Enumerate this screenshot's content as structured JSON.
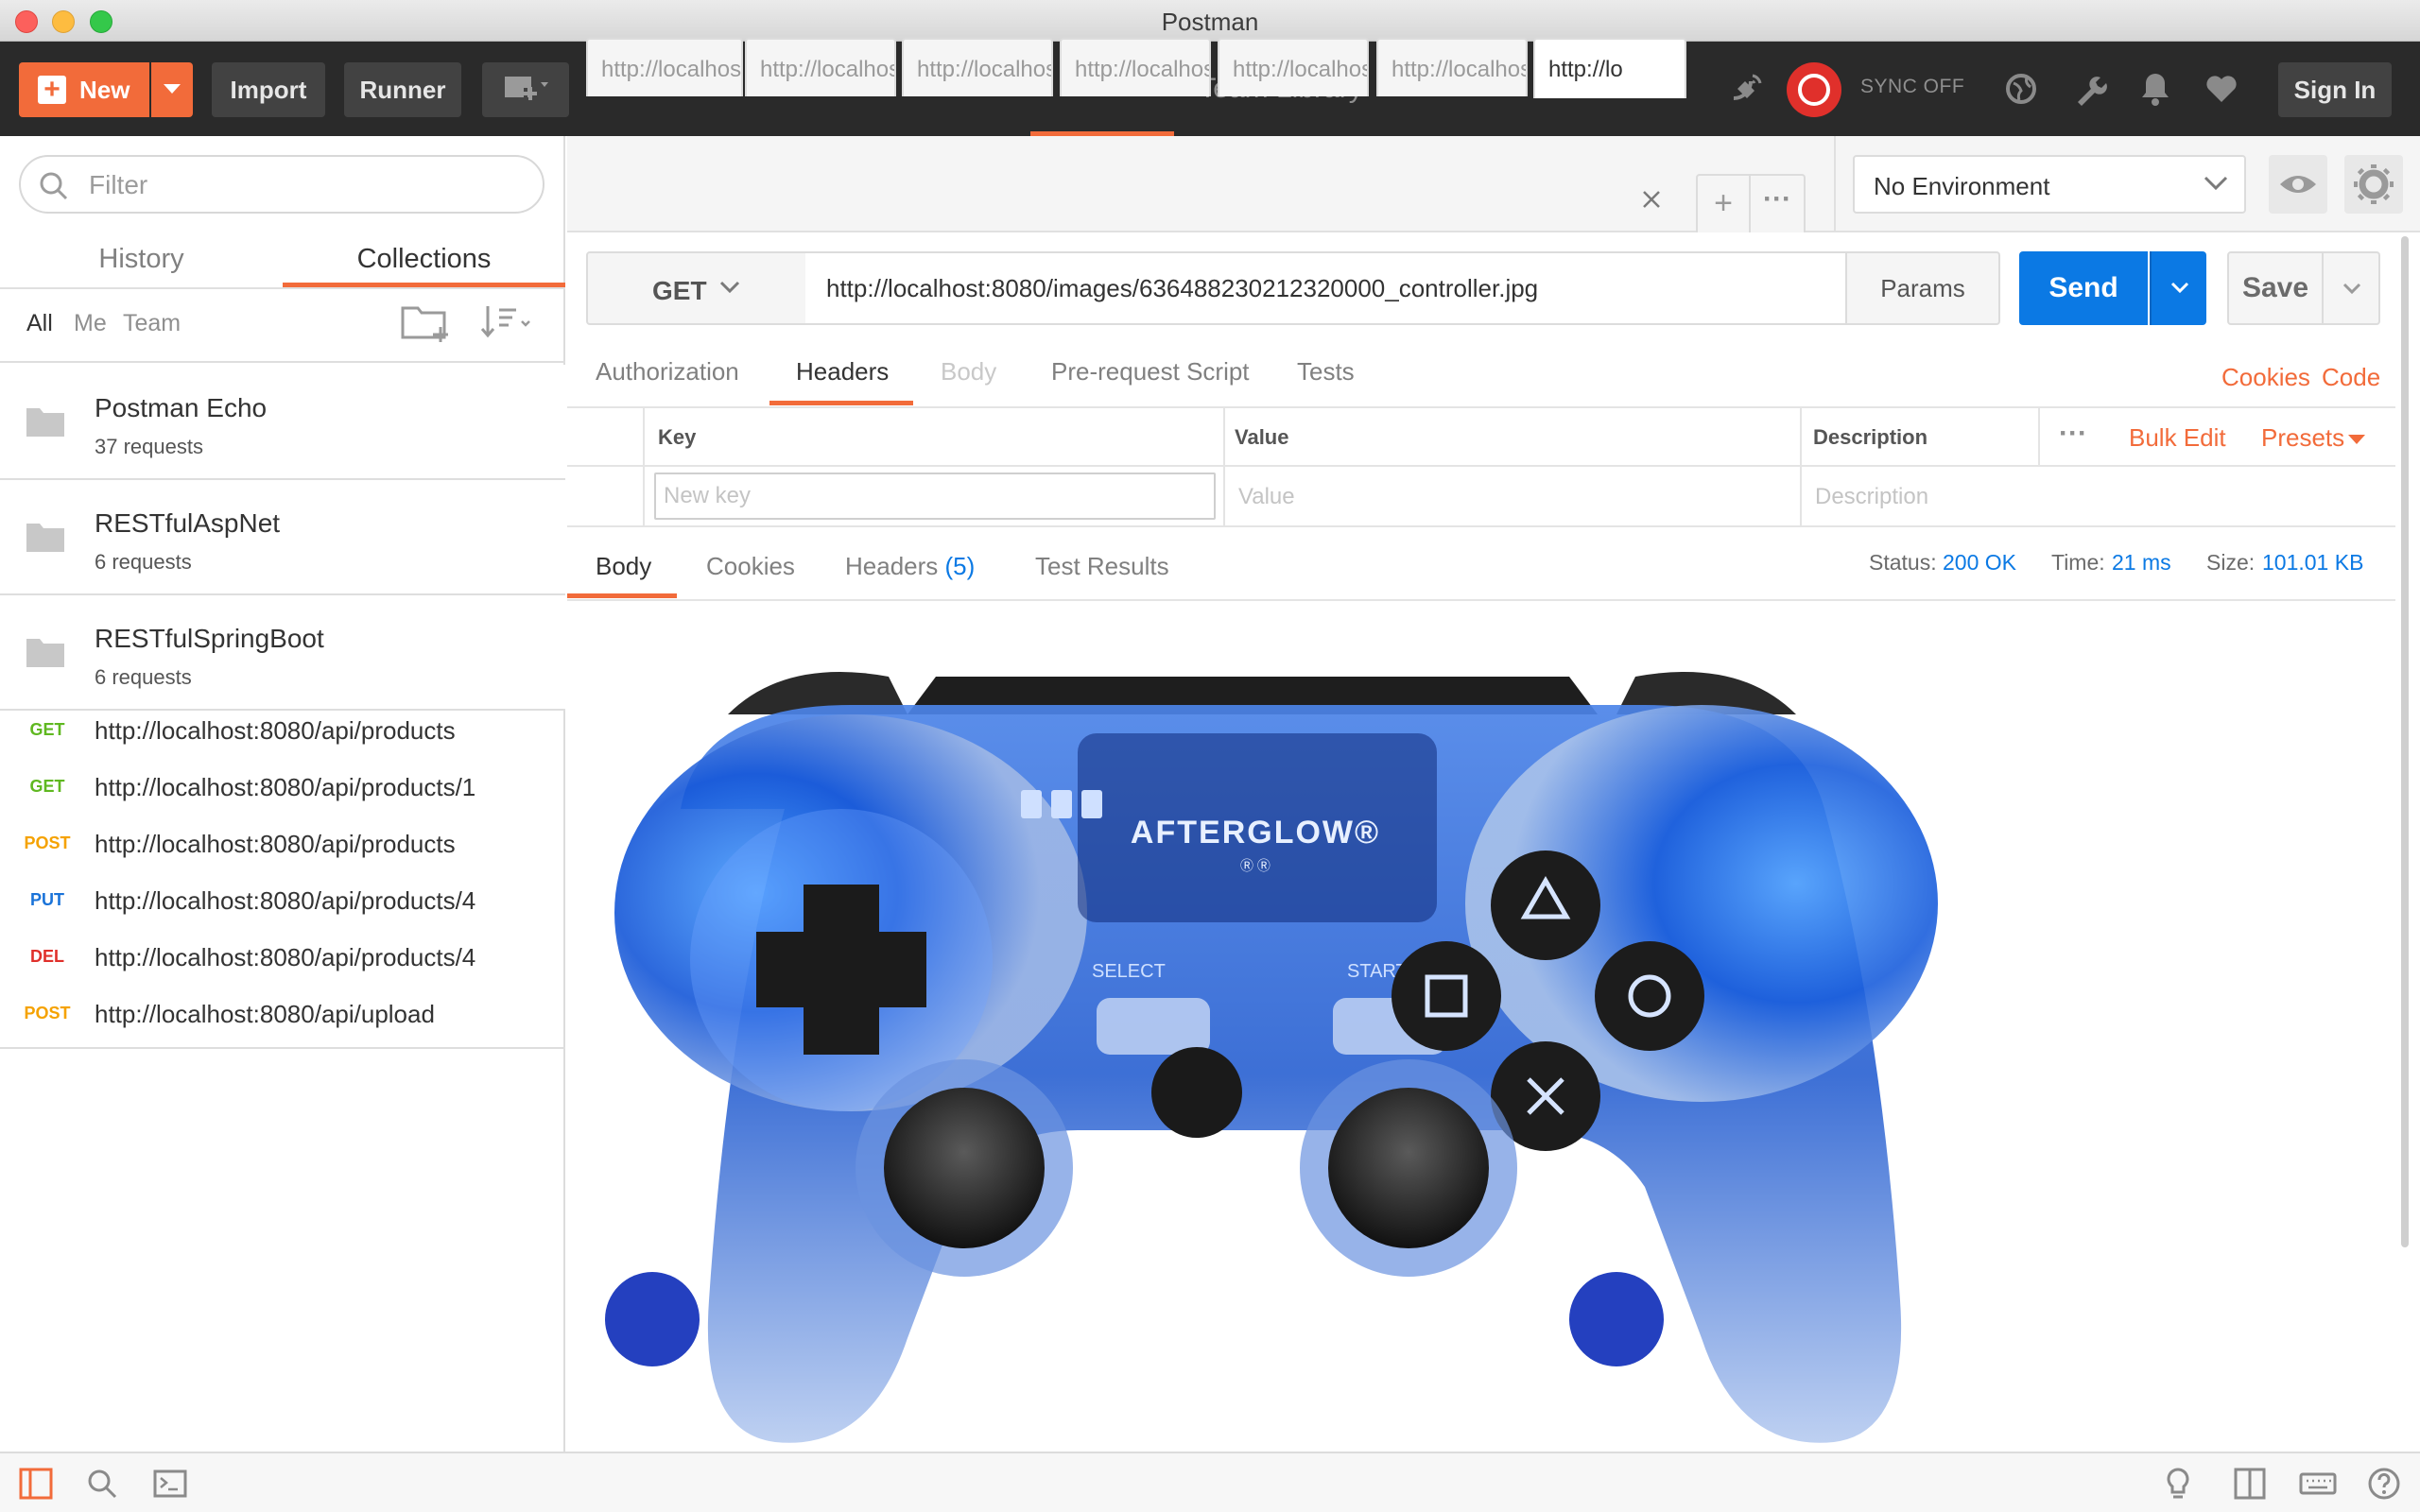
{
  "window": {
    "title": "Postman"
  },
  "header": {
    "new_label": "New",
    "import_label": "Import",
    "runner_label": "Runner",
    "builder_label": "Builder",
    "team_library_label": "Team Library",
    "sync_label": "SYNC OFF",
    "signin_label": "Sign In",
    "accent": "#f26b3a",
    "sync_color": "#e0302b"
  },
  "sidebar": {
    "filter_placeholder": "Filter",
    "tabs": {
      "history": "History",
      "collections": "Collections"
    },
    "filters": {
      "all": "All",
      "me": "Me",
      "team": "Team"
    },
    "collections": [
      {
        "name": "Postman Echo",
        "requests": "37 requests"
      },
      {
        "name": "RESTfulAspNet",
        "requests": "6 requests"
      },
      {
        "name": "RESTfulSpringBoot",
        "requests": "6 requests"
      }
    ],
    "history": [
      {
        "method": "GET",
        "url": "http://localhost:8080/api/products",
        "color": "#5fb820"
      },
      {
        "method": "GET",
        "url": "http://localhost:8080/api/products/1",
        "color": "#5fb820"
      },
      {
        "method": "POST",
        "url": "http://localhost:8080/api/products",
        "color": "#f5a200"
      },
      {
        "method": "PUT",
        "url": "http://localhost:8080/api/products/4",
        "color": "#1a73d9"
      },
      {
        "method": "DEL",
        "url": "http://localhost:8080/api/products/4",
        "color": "#e0302b"
      },
      {
        "method": "POST",
        "url": "http://localhost:8080/api/upload",
        "color": "#f5a200"
      }
    ]
  },
  "request_tabs": [
    {
      "label": "http://localhost"
    },
    {
      "label": "http://localhost"
    },
    {
      "label": "http://localhost"
    },
    {
      "label": "http://localhost"
    },
    {
      "label": "http://localhost"
    },
    {
      "label": "http://localhost"
    },
    {
      "label": "http://lo"
    }
  ],
  "environment": {
    "selected": "No Environment"
  },
  "request": {
    "method": "GET",
    "url": "http://localhost:8080/images/636488230212320000_controller.jpg",
    "params_label": "Params",
    "send_label": "Send",
    "save_label": "Save",
    "send_color": "#0b79e4"
  },
  "request_subtabs": {
    "authorization": "Authorization",
    "headers": "Headers",
    "body": "Body",
    "prerequest": "Pre-request Script",
    "tests": "Tests",
    "cookies": "Cookies",
    "code": "Code"
  },
  "headers_table": {
    "key": "Key",
    "value": "Value",
    "description": "Description",
    "bulk_edit": "Bulk Edit",
    "presets": "Presets",
    "new_key_placeholder": "New key",
    "value_placeholder": "Value",
    "description_placeholder": "Description"
  },
  "response": {
    "tabs": {
      "body": "Body",
      "cookies": "Cookies",
      "headers": "Headers",
      "headers_count": "(5)",
      "test_results": "Test Results"
    },
    "status_label": "Status:",
    "status_value": "200 OK",
    "time_label": "Time:",
    "time_value": "21 ms",
    "size_label": "Size:",
    "size_value": "101.01 KB",
    "image": {
      "brand": "AFTERGLOW®",
      "sub": "Ⓡ Ⓡ",
      "select": "SELECT",
      "start": "START"
    }
  }
}
